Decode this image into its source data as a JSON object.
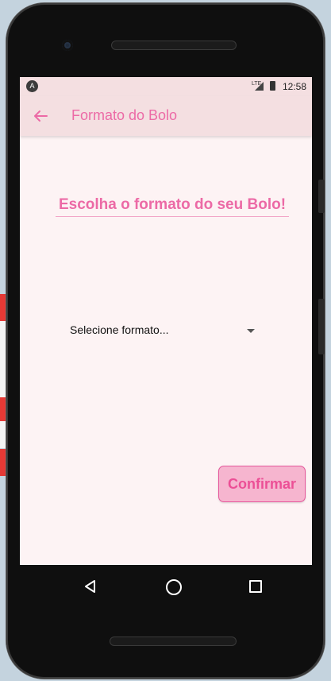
{
  "status_bar": {
    "app_icon": "A",
    "network": "LTE",
    "time": "12:58"
  },
  "app_bar": {
    "back_icon": "arrow-back-icon",
    "title": "Formato do Bolo",
    "accent_color": "#ec6aa6"
  },
  "main": {
    "heading": "Escolha o formato do seu Bolo!",
    "format_select": {
      "placeholder": "Selecione formato..."
    },
    "confirm_label": "Confirmar"
  },
  "nav_bar": {
    "icons": [
      "back-triangle-icon",
      "home-circle-icon",
      "recents-square-icon"
    ]
  },
  "colors": {
    "app_bar_bg": "#f4dfe1",
    "screen_bg": "#fdf3f4",
    "button_bg": "#f6b5cf",
    "button_text": "#ec4f96"
  }
}
